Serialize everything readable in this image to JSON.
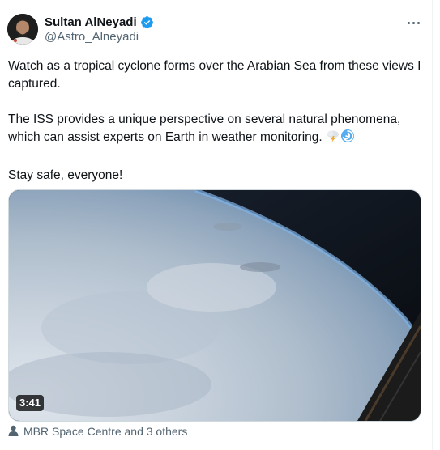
{
  "author": {
    "display_name": "Sultan AlNeyadi",
    "handle": "@Astro_Alneyadi",
    "verified": true
  },
  "tweet": {
    "paragraph1": "Watch as a tropical cyclone forms over the Arabian Sea from these views I captured.",
    "paragraph2": "The ISS provides a unique perspective on several natural phenomena, which can assist experts on Earth in weather monitoring.",
    "paragraph3": "Stay safe, everyone!",
    "emojis": [
      "cloud-lightning-icon",
      "cyclone-icon"
    ]
  },
  "media": {
    "duration": "3:41"
  },
  "tagged": {
    "label": "MBR Space Centre and 3 others"
  },
  "colors": {
    "text": "#0f1419",
    "secondary": "#536471",
    "verified": "#1d9bf0"
  }
}
